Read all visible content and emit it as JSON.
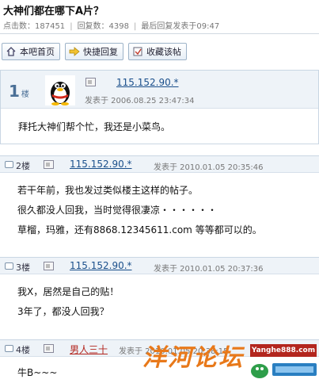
{
  "thread": {
    "title": "大神们都在哪下A片？",
    "stats": {
      "clicks": "点击数：187451",
      "replies": "回复数：4398",
      "last_reply": "最后回复发表于09:47"
    }
  },
  "toolbar": {
    "home_label": "本吧首页",
    "quick_reply_label": "快捷回复",
    "favorite_label": "收藏该帖"
  },
  "posts": [
    {
      "floor": "1",
      "floor_suffix": "楼",
      "user": "115.152.90.*",
      "date": "发表于  2006.08.25 23:47:34",
      "lines": [
        "拜托大神们帮个忙，我还是小菜鸟。"
      ]
    },
    {
      "floor": "2楼",
      "user": "115.152.90.*",
      "date": "发表于  2010.01.05 20:35:46",
      "lines": [
        "若干年前，我也发过类似楼主这样的帖子。",
        "很久都没人回我，当时觉得很凄凉・・・・・・",
        "草榴，玛雅，还有8868.12345611.com 等等都可以的。"
      ]
    },
    {
      "floor": "3楼",
      "user": "115.152.90.*",
      "date": "发表于  2010.01.05 20:37:36",
      "lines": [
        "我X，居然是自己的贴！",
        "3年了，都没人回我？"
      ]
    },
    {
      "floor": "4楼",
      "user": "男人三十",
      "date": "发表于 2010.01.05 20:38:15",
      "lines": [
        "牛B~~~"
      ]
    }
  ],
  "watermark": {
    "site_cn": "洋河论坛",
    "site_url": "Yanghe888.com"
  },
  "colors": {
    "link": "#1a4f8b",
    "header_bg": "#eef3f8",
    "border": "#c9d6e3",
    "watermark_orange": "#e8791a",
    "watermark_red": "#b3261e"
  }
}
